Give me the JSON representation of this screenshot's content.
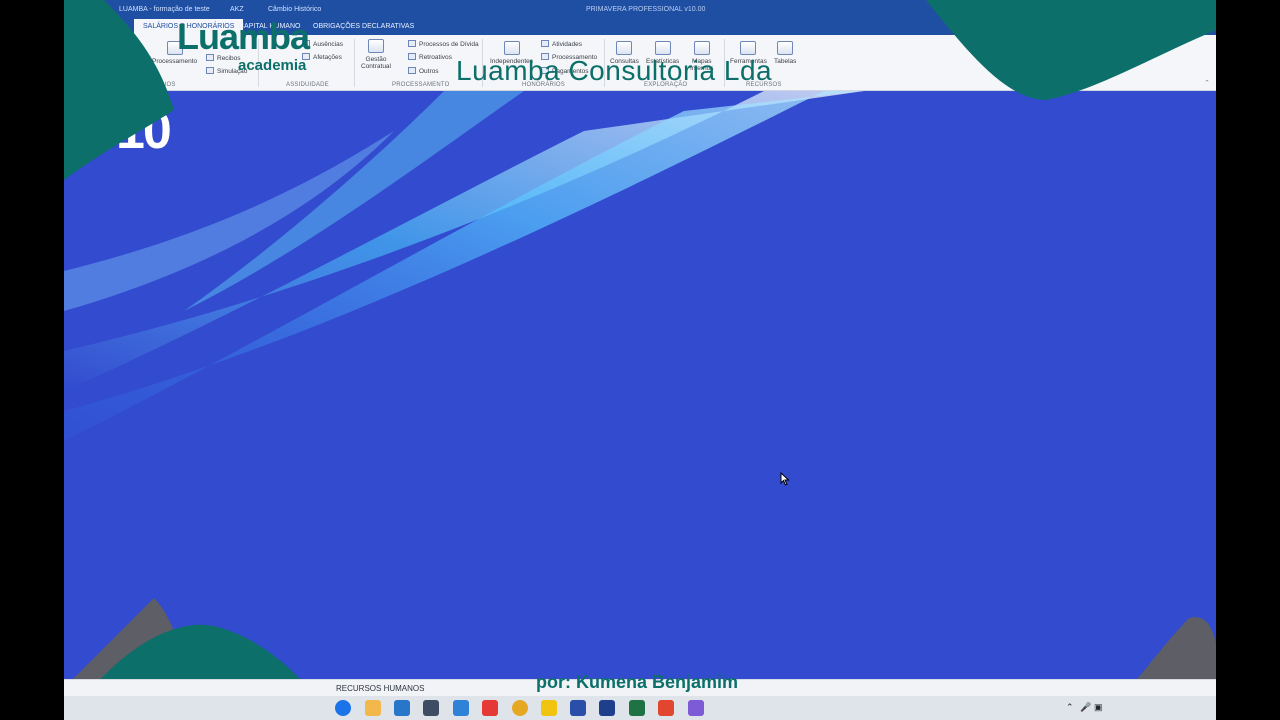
{
  "titlebar": {
    "company": "LUAMBA - formação de teste",
    "currency": "AKZ",
    "exchange": "Câmbio Histórico",
    "app_title": "PRIMAVERA PROFESSIONAL v10.00"
  },
  "tabs": [
    {
      "label": "SALÁRIOS E HONORÁRIOS",
      "active": true
    },
    {
      "label": "CAPITAL HUMANO",
      "active": false
    },
    {
      "label": "OBRIGAÇÕES DECLARATIVAS",
      "active": false
    }
  ],
  "ribbon": {
    "processamento_btn": "Processamento",
    "recibos": "Recibos",
    "simulacao": "Simulação",
    "ausencias": "Ausências",
    "afetacoes": "Afetações",
    "gestao": "Gestão",
    "contratual": "Contratual",
    "processos_divida": "Processos de Dívida",
    "retroativos": "Retroativos",
    "outros": "Outros",
    "independentes": "Independentes",
    "atividades": "Atividades",
    "processamento2": "Processamento",
    "pagamentos": "Pagamentos",
    "consultas": "Consultas",
    "estatisticas": "Estatísticas",
    "mapas": "Mapas",
    "internos": "Internos",
    "ferramentas": "Ferramentas",
    "tabelas": "Tabelas",
    "groups": {
      "salarios": "SALÁRIOS",
      "assiduidade": "ASSIDUIDADE",
      "processamento": "PROCESSAMENTO",
      "honorarios": "HONORÁRIOS",
      "exploracao": "EXPLORAÇÃO",
      "recursos": "RECURSOS"
    }
  },
  "desktop": {
    "version_fragment": "10"
  },
  "watermark": {
    "brand": "Luamba",
    "sub": "academia",
    "company": "Luamba Consultoria Lda",
    "author": "por: Kumena Benjamim"
  },
  "statusbar": {
    "module": "RECURSOS HUMANOS"
  },
  "colors": {
    "accent": "#1f4fa3",
    "desktop": "#324bcf",
    "watermark": "#0c6f6a"
  }
}
